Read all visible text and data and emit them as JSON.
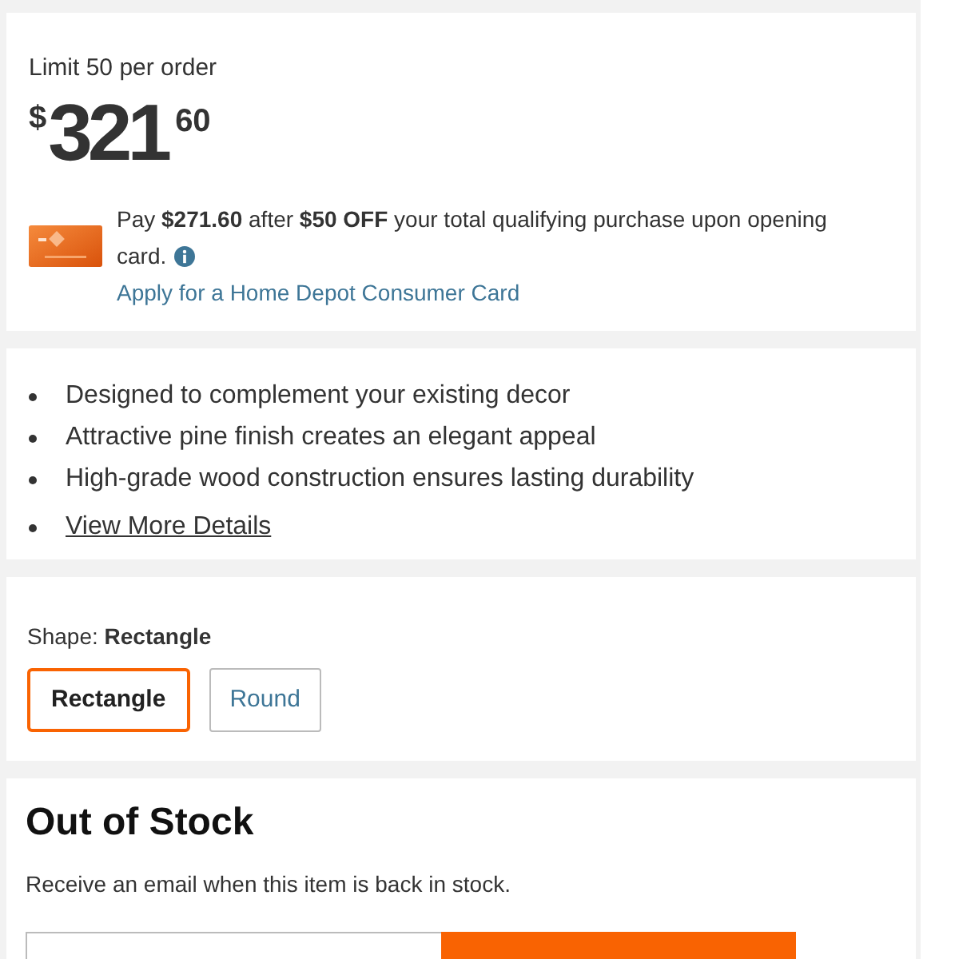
{
  "price_panel": {
    "limit": "Limit 50 per order",
    "price": {
      "currency": "$",
      "dollars": "321",
      "cents": "60"
    },
    "offer": {
      "lines": [
        "Pay **$271.60** after **$50 OFF** your total qualifying purchase upon opening",
        "card."
      ],
      "link": "Apply for a Home Depot Consumer Card"
    }
  },
  "features": {
    "items": [
      "Designed to complement your existing decor",
      "Attractive pine finish creates an elegant appeal",
      "High-grade wood construction ensures lasting durability"
    ],
    "link": "View More Details"
  },
  "shape_picker": {
    "label": "Shape: **Rectangle**",
    "options": [
      {
        "label": "Rectangle",
        "selected": true
      },
      {
        "label": "Round",
        "selected": false
      }
    ]
  },
  "stock": {
    "title": "Out of Stock",
    "message": "Receive an email when this item is back in stock."
  }
}
